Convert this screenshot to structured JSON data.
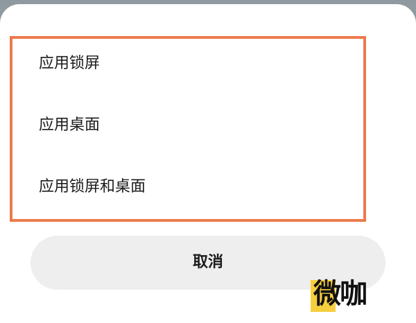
{
  "dialog": {
    "options": [
      {
        "label": "应用锁屏"
      },
      {
        "label": "应用桌面"
      },
      {
        "label": "应用锁屏和桌面"
      }
    ],
    "cancel_label": "取消"
  },
  "watermark": {
    "text": "微咖"
  },
  "colors": {
    "highlight_border": "#ec7a4d",
    "cancel_bg": "#eeeeee",
    "watermark_accent": "#f6cf3f"
  }
}
